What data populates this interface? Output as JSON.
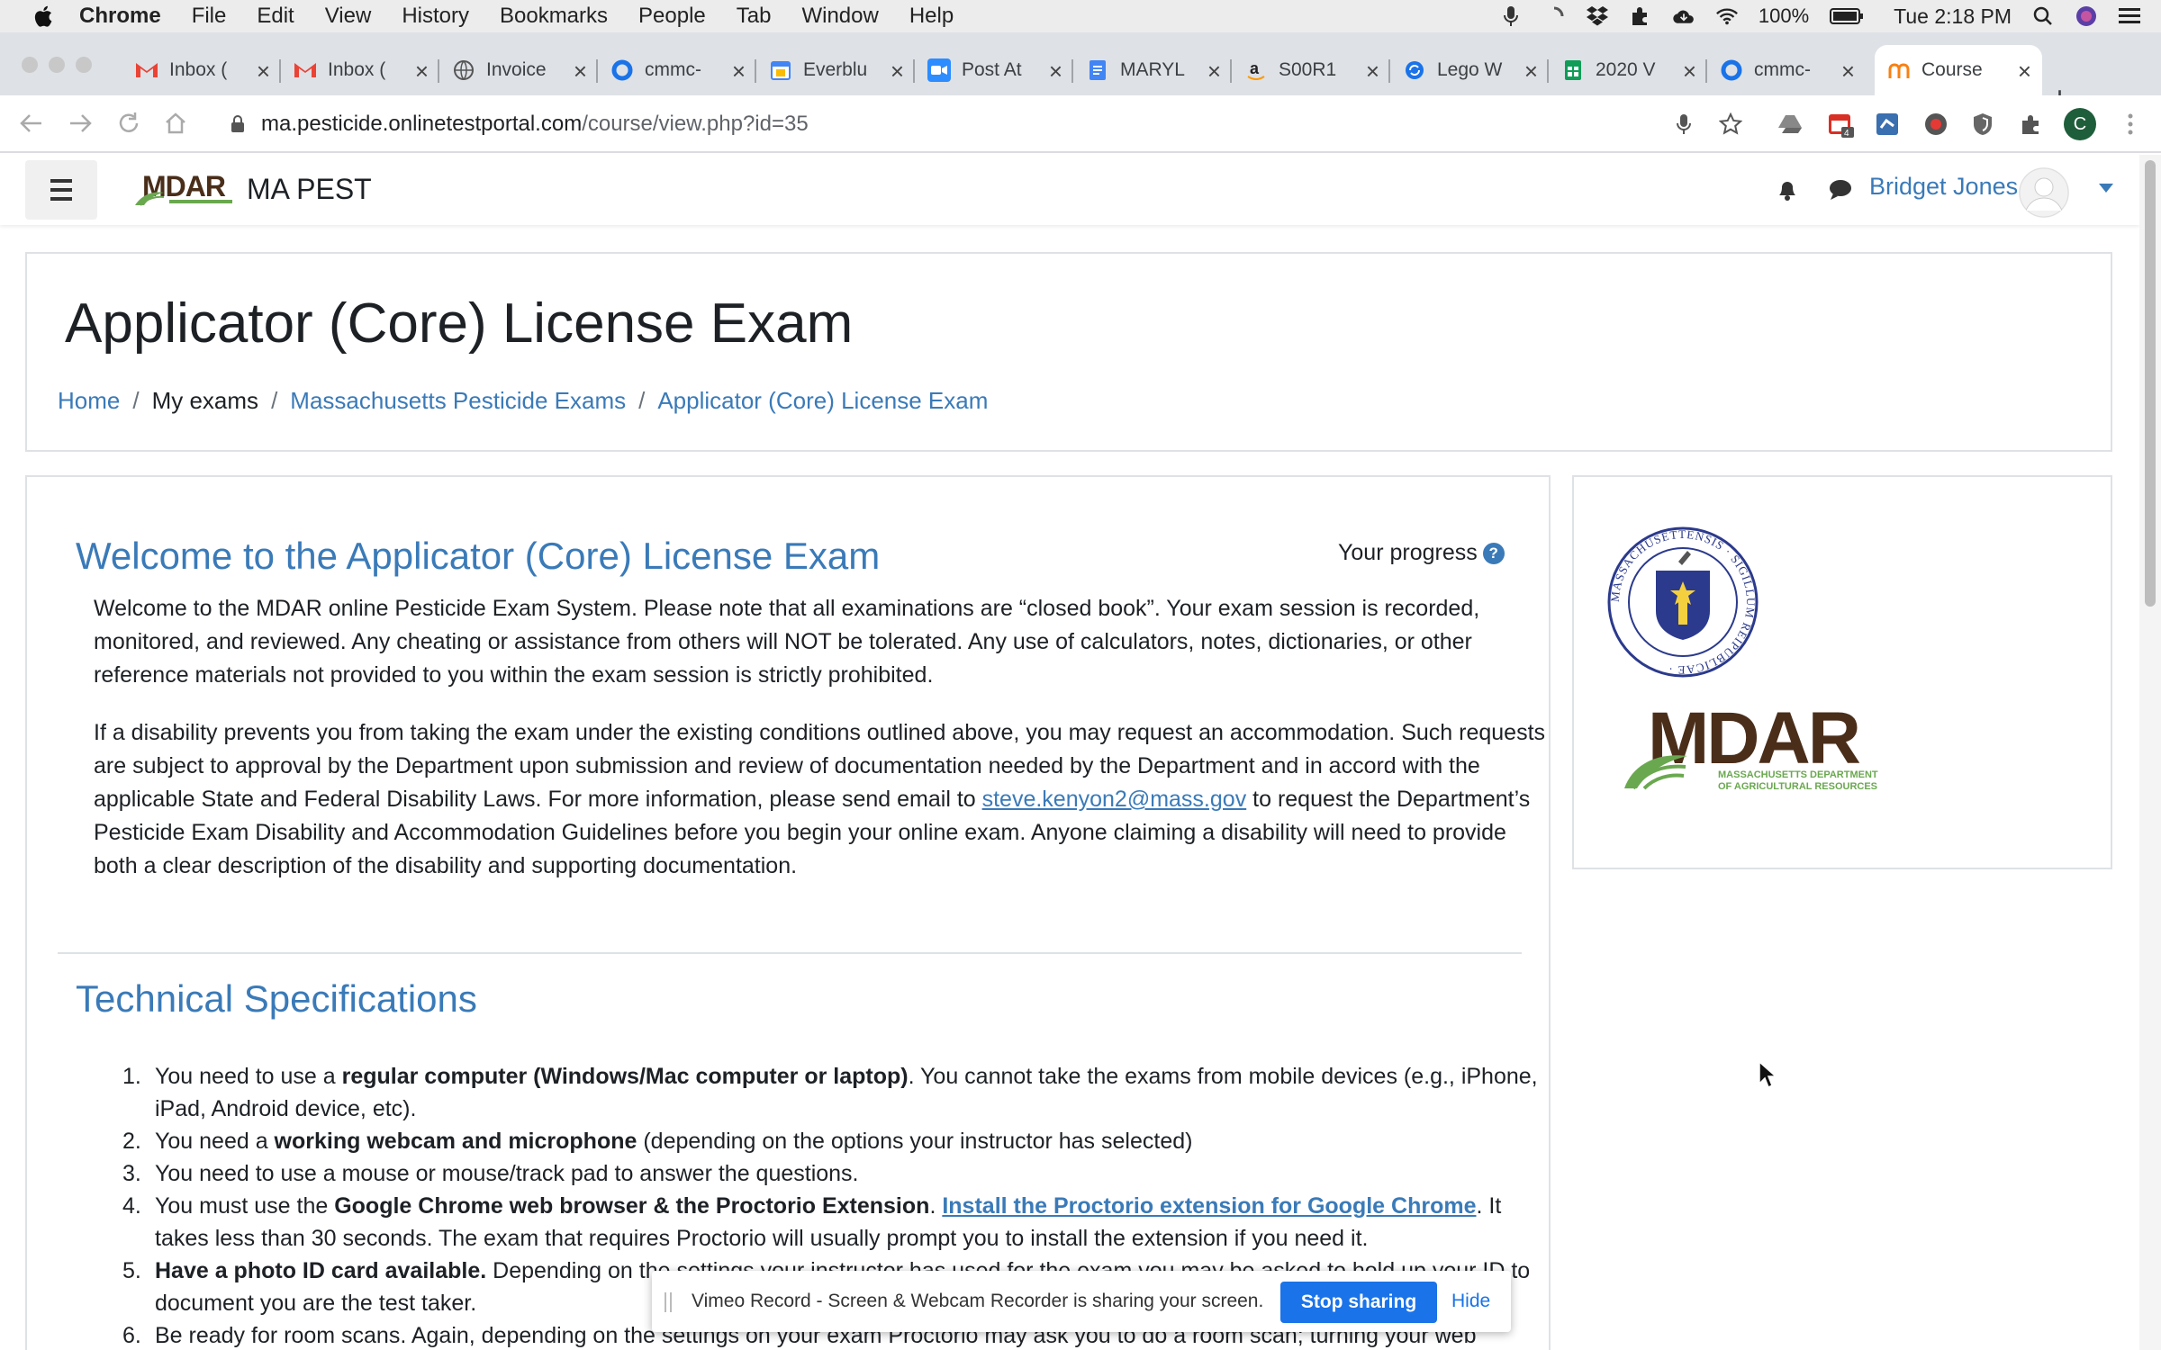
{
  "menubar": {
    "app": "Chrome",
    "items": [
      "File",
      "Edit",
      "View",
      "History",
      "Bookmarks",
      "People",
      "Tab",
      "Window",
      "Help"
    ],
    "battery": "100%",
    "clock": "Tue 2:18 PM"
  },
  "tabs": [
    {
      "title": "Inbox (",
      "favicon": "gmail-icon",
      "color": "#ea4335"
    },
    {
      "title": "Inbox (",
      "favicon": "gmail-icon",
      "color": "#ea4335"
    },
    {
      "title": "Invoice",
      "favicon": "globe-icon",
      "color": "#555555"
    },
    {
      "title": "cmmc-",
      "favicon": "circle-icon",
      "color": "#1a73e8"
    },
    {
      "title": "Everblu",
      "favicon": "calendar-icon",
      "color": "#4285f4"
    },
    {
      "title": "Post At",
      "favicon": "zoom-icon",
      "color": "#2d8cff"
    },
    {
      "title": "MARYL",
      "favicon": "docs-icon",
      "color": "#4285f4"
    },
    {
      "title": "S00R1",
      "favicon": "amazon-icon",
      "color": "#222222"
    },
    {
      "title": "Lego W",
      "favicon": "refresh-icon",
      "color": "#1a73e8"
    },
    {
      "title": "2020 V",
      "favicon": "sheets-icon",
      "color": "#0f9d58"
    },
    {
      "title": "cmmc-",
      "favicon": "circle-icon",
      "color": "#1a73e8"
    },
    {
      "title": "Course",
      "favicon": "moodle-icon",
      "color": "#f98012"
    }
  ],
  "address_bar": {
    "url_host": "ma.pesticide.onlinetestportal.com",
    "url_path": "/course/view.php?id=35"
  },
  "site": {
    "name": "MA PEST",
    "user_name": "Bridget Jones"
  },
  "page": {
    "title": "Applicator (Core) License Exam",
    "breadcrumb": {
      "home": "Home",
      "my_exams": "My exams",
      "category": "Massachusetts Pesticide Exams",
      "course": "Applicator (Core) License Exam"
    }
  },
  "main": {
    "welcome_heading": "Welcome to the Applicator (Core) License Exam",
    "progress_label": "Your progress",
    "para1": "Welcome to the MDAR online Pesticide Exam System. Please note that all examinations are “closed book”. Your exam session is recorded, monitored, and reviewed. Any cheating or assistance from others will NOT be tolerated. Any use of calculators, notes, dictionaries, or other reference materials not provided to you within the exam session is strictly prohibited.",
    "para2_before": "If a disability prevents you from taking the exam under the existing conditions outlined above, you may request an accommodation. Such requests are subject to approval by the Department upon submission and review of documentation needed by the Department and in accord with the applicable State and Federal Disability Laws. For more information, please send email to ",
    "para2_email": "steve.kenyon2@mass.gov",
    "para2_after": " to request the Department’s Pesticide Exam Disability and Accommodation Guidelines before you begin your online exam. Anyone claiming a disability will need to provide both a clear description of the disability and supporting documentation.",
    "tech_heading": "Technical Specifications",
    "tech_items": [
      {
        "num": "1.",
        "pre": "You need to use a ",
        "bold": "regular computer (Windows/Mac computer or laptop)",
        "post": ". You cannot take the exams from mobile devices (e.g., iPhone, iPad, Android device, etc)."
      },
      {
        "num": "2.",
        "pre": "You need a ",
        "bold": "working webcam and microphone",
        "post": " (depending on the options your instructor has selected)"
      },
      {
        "num": "3.",
        "text": "You need to use a mouse or mouse/track pad to answer the questions."
      },
      {
        "num": "4.",
        "pre": "You must use the ",
        "bold": "Google Chrome web browser & the Proctorio Extension",
        "mid": ". ",
        "link": "Install the Proctorio extension for Google Chrome",
        "post": ". It takes less than 30 seconds. The exam that requires Proctorio will usually prompt you to install the extension if you need it."
      },
      {
        "num": "5.",
        "bold": "Have a photo ID card available.",
        "post": " Depending on the settings your instructor has used for the exam you may be asked to hold up your ID to document you are the test taker."
      },
      {
        "num": "6.",
        "text": "Be ready for room scans. Again, depending on the settings on your exam Proctorio may ask you to do a room scan; turning your web"
      }
    ]
  },
  "side": {
    "seal_text": "MASSACHUSETTENSIS · SIGILLUM REIPUBLICAE ·",
    "logo_text": "MDAR",
    "logo_subtitle_1": "MASSACHUSETTS DEPARTMENT",
    "logo_subtitle_2": "OF AGRICULTURAL RESOURCES"
  },
  "sharebar": {
    "text": "Vimeo Record - Screen & Webcam Recorder is sharing your screen.",
    "stop_label": "Stop sharing",
    "hide_label": "Hide"
  },
  "colors": {
    "link": "#3a7ab8",
    "mdar_brown": "#4a2e1a",
    "mdar_green": "#6aa84f",
    "share_button": "#1a73e8"
  }
}
